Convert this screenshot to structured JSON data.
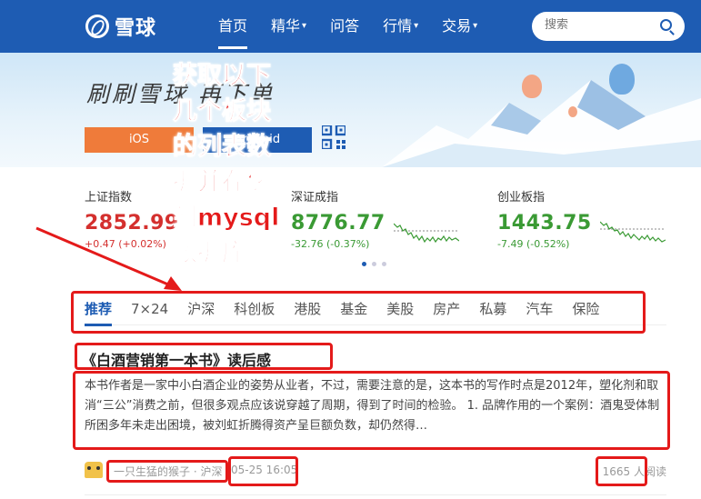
{
  "header": {
    "logo_text": "雪球",
    "nav": [
      {
        "label": "首页",
        "has_menu": false,
        "active": true
      },
      {
        "label": "精华",
        "has_menu": true,
        "active": false
      },
      {
        "label": "问答",
        "has_menu": false,
        "active": false
      },
      {
        "label": "行情",
        "has_menu": true,
        "active": false
      },
      {
        "label": "交易",
        "has_menu": true,
        "active": false
      }
    ],
    "search_placeholder": "搜索",
    "caret_glyph": "▾"
  },
  "banner": {
    "slogan": "刷刷雪球  再下单",
    "ios_label": "iOS",
    "android_label": "Android"
  },
  "indices": [
    {
      "name": "上证指数",
      "value": "2852.99",
      "change": "+0.47 (+0.02%)",
      "trend": "up"
    },
    {
      "name": "深证成指",
      "value": "8776.77",
      "change": "-32.76 (-0.37%)",
      "trend": "down"
    },
    {
      "name": "创业板指",
      "value": "1443.75",
      "change": "-7.49 (-0.52%)",
      "trend": "down"
    }
  ],
  "tabs": [
    {
      "label": "推荐",
      "active": true
    },
    {
      "label": "7×24",
      "active": false
    },
    {
      "label": "沪深",
      "active": false
    },
    {
      "label": "科创板",
      "active": false
    },
    {
      "label": "港股",
      "active": false
    },
    {
      "label": "基金",
      "active": false
    },
    {
      "label": "美股",
      "active": false
    },
    {
      "label": "房产",
      "active": false
    },
    {
      "label": "私募",
      "active": false
    },
    {
      "label": "汽车",
      "active": false
    },
    {
      "label": "保险",
      "active": false
    }
  ],
  "article": {
    "title": "《白酒营销第一本书》读后感",
    "body": "本书作者是一家中小白酒企业的姿势从业者，不过，需要注意的是，这本书的写作时点是2012年，塑化剂和取消“三公”消费之前，但很多观点应该说穿越了周期，得到了时间的检验。 1. 品牌作用的一个案例：酒鬼受体制所困多年未走出困境，被刘虹折腾得资产呈巨额负数，却仍然得…",
    "author": "一只生猛的猴子 · 沪深",
    "time": "05-25 16:05",
    "reads": "1665 人阅读"
  },
  "annotation": {
    "text": "获取以下几个板块的列表数据并存储到mysql数据库"
  },
  "colors": {
    "brand": "#1e5cb3",
    "up": "#d4302e",
    "down": "#3a9a34",
    "annotation": "#e41a1a",
    "ios_button": "#ef7b3a"
  }
}
